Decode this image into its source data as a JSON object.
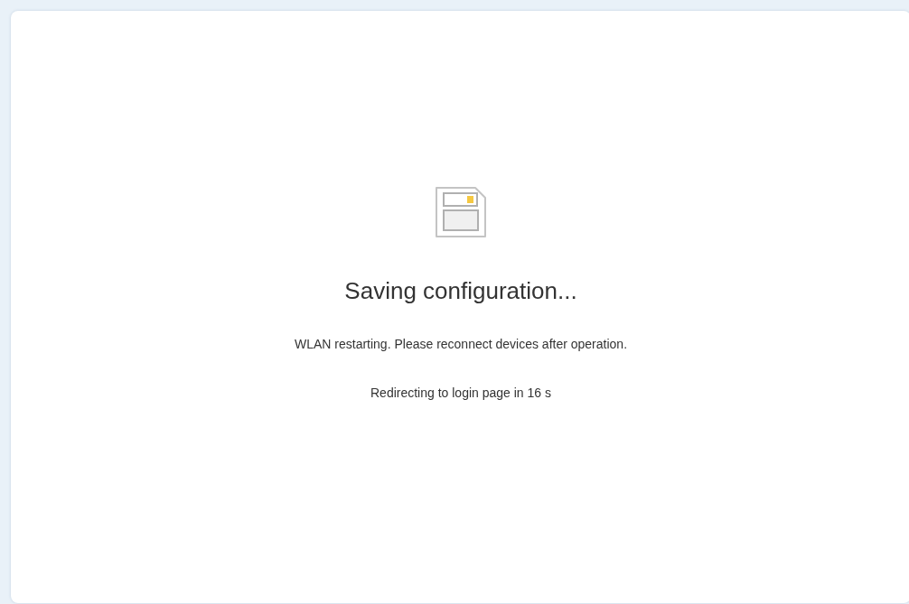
{
  "dialog": {
    "title": "Saving configuration...",
    "message": "WLAN restarting. Please reconnect devices after operation.",
    "redirect": "Redirecting to login page in 16 s"
  }
}
